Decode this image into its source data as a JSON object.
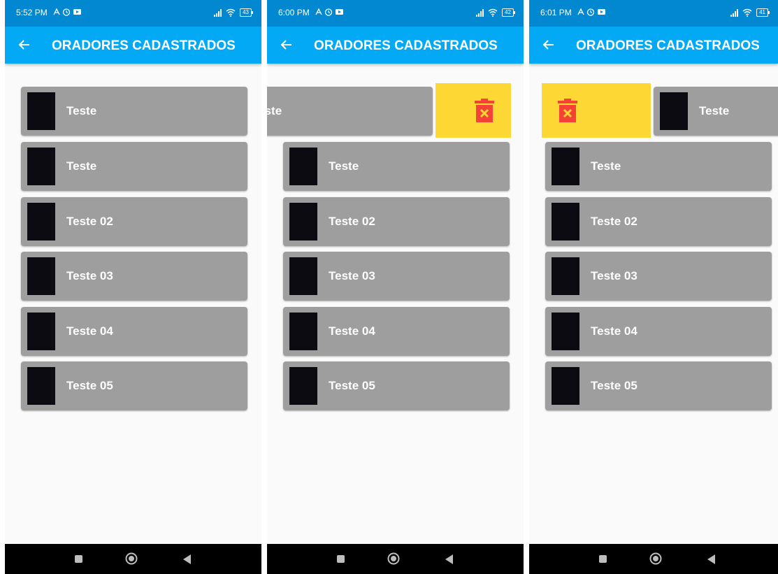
{
  "screens": [
    {
      "status": {
        "time": "5:52 PM",
        "battery": "43"
      },
      "title": "ORADORES CADASTRADOS",
      "items": [
        {
          "label": "Teste"
        },
        {
          "label": "Teste"
        },
        {
          "label": "Teste 02"
        },
        {
          "label": "Teste 03"
        },
        {
          "label": "Teste 04"
        },
        {
          "label": "Teste 05"
        }
      ]
    },
    {
      "status": {
        "time": "6:00 PM",
        "battery": "42"
      },
      "title": "ORADORES CADASTRADOS",
      "swiped_item": {
        "label": "Teste",
        "direction": "left"
      },
      "items": [
        {
          "label": "Teste"
        },
        {
          "label": "Teste 02"
        },
        {
          "label": "Teste 03"
        },
        {
          "label": "Teste 04"
        },
        {
          "label": "Teste 05"
        }
      ]
    },
    {
      "status": {
        "time": "6:01 PM",
        "battery": "41"
      },
      "title": "ORADORES CADASTRADOS",
      "swiped_item": {
        "label": "Teste",
        "direction": "right"
      },
      "items": [
        {
          "label": "Teste"
        },
        {
          "label": "Teste 02"
        },
        {
          "label": "Teste 03"
        },
        {
          "label": "Teste 04"
        },
        {
          "label": "Teste 05"
        }
      ]
    }
  ],
  "colors": {
    "status_bar": "#0288d1",
    "app_bar": "#03a9f4",
    "list_item": "#9e9e9e",
    "delete_background": "#fdd835",
    "delete_icon": "#f44336"
  },
  "icons": {
    "back": "arrow-left-icon",
    "delete": "trash-icon",
    "nav_recent": "square-icon",
    "nav_home": "circle-icon",
    "nav_back": "triangle-left-icon"
  }
}
